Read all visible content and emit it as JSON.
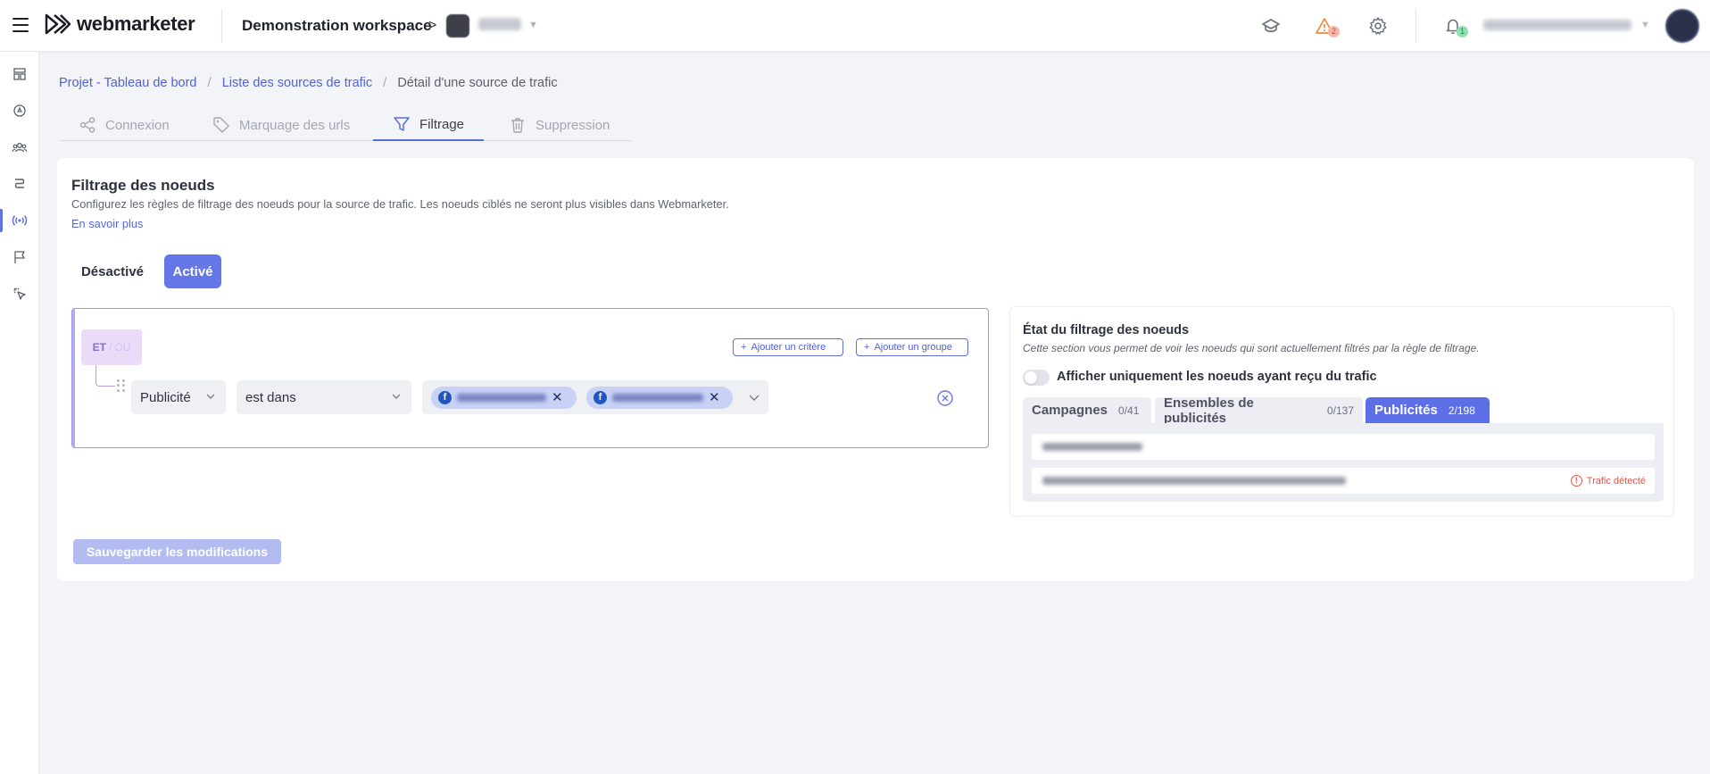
{
  "header": {
    "logo_text": "webmarketer",
    "workspace": "Demonstration workspace",
    "workspace_chevron": ">",
    "project_name": "Demo",
    "notifications_warning_count": "2",
    "notifications_bell_count": "1",
    "user_email": "demo.user@webmarketer.com"
  },
  "sidebar": {
    "items": [
      {
        "icon": "dashboard-icon"
      },
      {
        "icon": "target-icon"
      },
      {
        "icon": "users-icon"
      },
      {
        "icon": "path-icon"
      },
      {
        "icon": "broadcast-icon"
      },
      {
        "icon": "flag-icon"
      },
      {
        "icon": "cursor-click-icon"
      }
    ],
    "active_index": 4
  },
  "breadcrumb": {
    "items": [
      "Projet - Tableau de bord",
      "Liste des sources de trafic"
    ],
    "current": "Détail d'une source de trafic",
    "separator": "/"
  },
  "tabs": [
    {
      "label": "Connexion",
      "icon": "share-icon"
    },
    {
      "label": "Marquage des urls",
      "icon": "tag-icon"
    },
    {
      "label": "Filtrage",
      "icon": "filter-icon"
    },
    {
      "label": "Suppression",
      "icon": "trash-icon"
    }
  ],
  "active_tab": "Filtrage",
  "filter": {
    "title": "Filtrage des noeuds",
    "description": "Configurez les règles de filtrage des noeuds pour la source de trafic. Les noeuds ciblés ne seront plus visibles dans Webmarketer.",
    "learn_more": "En savoir plus",
    "toggle_off": "Désactivé",
    "toggle_on": "Activé",
    "selected_toggle": "Activé",
    "group": {
      "and": "ET",
      "or_sep": "/",
      "or": "OU",
      "add_criterion": "Ajouter un critère",
      "add_group": "Ajouter un groupe"
    },
    "criterion": {
      "field": "Publicité",
      "operator": "est dans",
      "values": [
        "Vidéo Rachat - Gaulles",
        "YBT - Retraitement"
      ]
    },
    "save_label": "Sauvegarder les modifications"
  },
  "state": {
    "title": "État du filtrage des noeuds",
    "description": "Cette section vous permet de voir les noeuds qui sont actuellement filtrés par la règle de filtrage.",
    "toggle_label": "Afficher uniquement les noeuds ayant reçu du trafic",
    "tabs": [
      {
        "label": "Campagnes",
        "count": "0/41"
      },
      {
        "label": "Ensembles de publicités",
        "count": "0/137"
      },
      {
        "label": "Publicités",
        "count": "2/198"
      }
    ],
    "active_tab": "Publicités",
    "rows": [
      {
        "name": "Vidéo Rachat - Gaulles",
        "traffic": ""
      },
      {
        "name": "YBT - Rtrot dynamique - PowerContent - Image seule",
        "traffic": "Trafic détecté"
      }
    ]
  },
  "colors": {
    "accent": "#6577e7",
    "link": "#5062d6",
    "warning": "#f08a3c",
    "danger": "#e0574c",
    "success": "#3cc27a"
  }
}
